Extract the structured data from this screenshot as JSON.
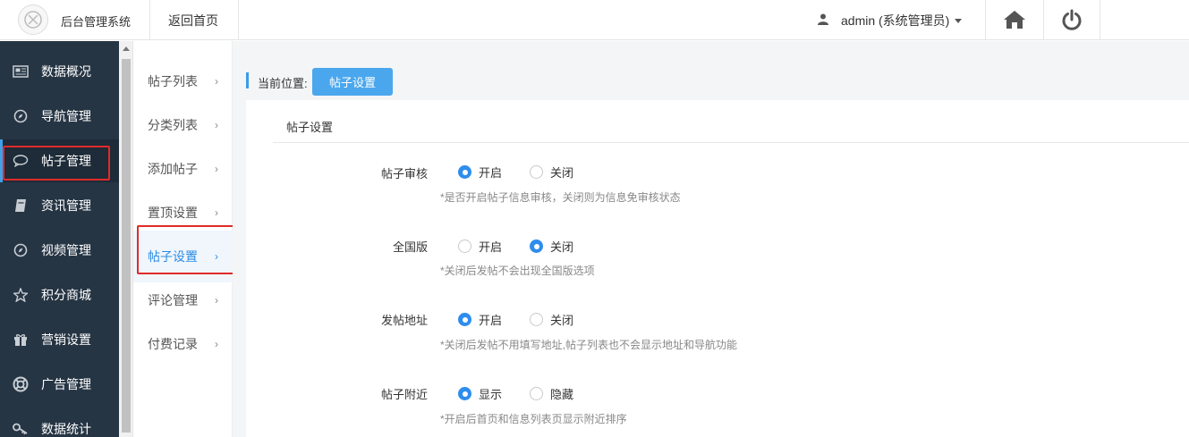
{
  "header": {
    "app_title": "后台管理系统",
    "home_link": "返回首页",
    "user_label": "admin (系统管理员)"
  },
  "sidebar": {
    "items": [
      {
        "label": "数据概况",
        "icon": "newspaper-icon"
      },
      {
        "label": "导航管理",
        "icon": "compass-icon"
      },
      {
        "label": "帖子管理",
        "icon": "comment-icon"
      },
      {
        "label": "资讯管理",
        "icon": "book-icon"
      },
      {
        "label": "视频管理",
        "icon": "compass-icon"
      },
      {
        "label": "积分商城",
        "icon": "star-icon"
      },
      {
        "label": "营销设置",
        "icon": "gift-icon"
      },
      {
        "label": "广告管理",
        "icon": "lifebuoy-icon"
      },
      {
        "label": "数据统计",
        "icon": "key-icon"
      }
    ],
    "active_index": 2
  },
  "submenu": {
    "items": [
      {
        "label": "帖子列表"
      },
      {
        "label": "分类列表"
      },
      {
        "label": "添加帖子"
      },
      {
        "label": "置顶设置"
      },
      {
        "label": "帖子设置"
      },
      {
        "label": "评论管理"
      },
      {
        "label": "付费记录"
      }
    ],
    "active_index": 4,
    "chevron": "›"
  },
  "breadcrumb": {
    "label": "当前位置:",
    "current": "帖子设置"
  },
  "panel": {
    "title": "帖子设置"
  },
  "settings": [
    {
      "label": "帖子审核",
      "options": [
        "开启",
        "关闭"
      ],
      "selected": 0,
      "hint": "*是否开启帖子信息审核，关闭则为信息免审核状态"
    },
    {
      "label": "全国版",
      "options": [
        "开启",
        "关闭"
      ],
      "selected": 1,
      "hint": "*关闭后发帖不会出现全国版选项"
    },
    {
      "label": "发帖地址",
      "options": [
        "开启",
        "关闭"
      ],
      "selected": 0,
      "hint": "*关闭后发帖不用填写地址,帖子列表也不会显示地址和导航功能"
    },
    {
      "label": "帖子附近",
      "options": [
        "显示",
        "隐藏"
      ],
      "selected": 0,
      "hint": "*开启后首页和信息列表页显示附近排序"
    }
  ],
  "colors": {
    "sidebar_bg": "#263544",
    "accent": "#2e8ded",
    "crumb_button": "#4aa7ee",
    "highlight_box": "#e02a2a"
  }
}
